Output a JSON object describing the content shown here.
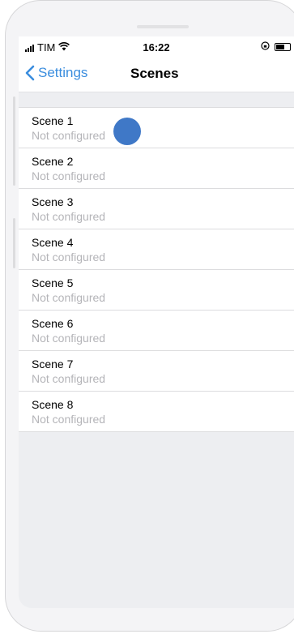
{
  "status_bar": {
    "carrier": "TIM",
    "time": "16:22",
    "signal_icon": "signal-bars-icon",
    "wifi_icon": "wifi-icon",
    "rotation_lock_icon": "rotation-lock-icon",
    "battery_icon": "battery-icon"
  },
  "nav": {
    "back_label": "Settings",
    "back_icon": "chevron-left-icon",
    "title": "Scenes"
  },
  "scenes": [
    {
      "title": "Scene 1",
      "status": "Not configured"
    },
    {
      "title": "Scene 2",
      "status": "Not configured"
    },
    {
      "title": "Scene 3",
      "status": "Not configured"
    },
    {
      "title": "Scene 4",
      "status": "Not configured"
    },
    {
      "title": "Scene 5",
      "status": "Not configured"
    },
    {
      "title": "Scene 6",
      "status": "Not configured"
    },
    {
      "title": "Scene 7",
      "status": "Not configured"
    },
    {
      "title": "Scene 8",
      "status": "Not configured"
    }
  ],
  "colors": {
    "accent": "#3a8dde",
    "subtitle": "#b4b4b8",
    "background": "#edeef1",
    "touch_indicator": "#3f78c7"
  }
}
